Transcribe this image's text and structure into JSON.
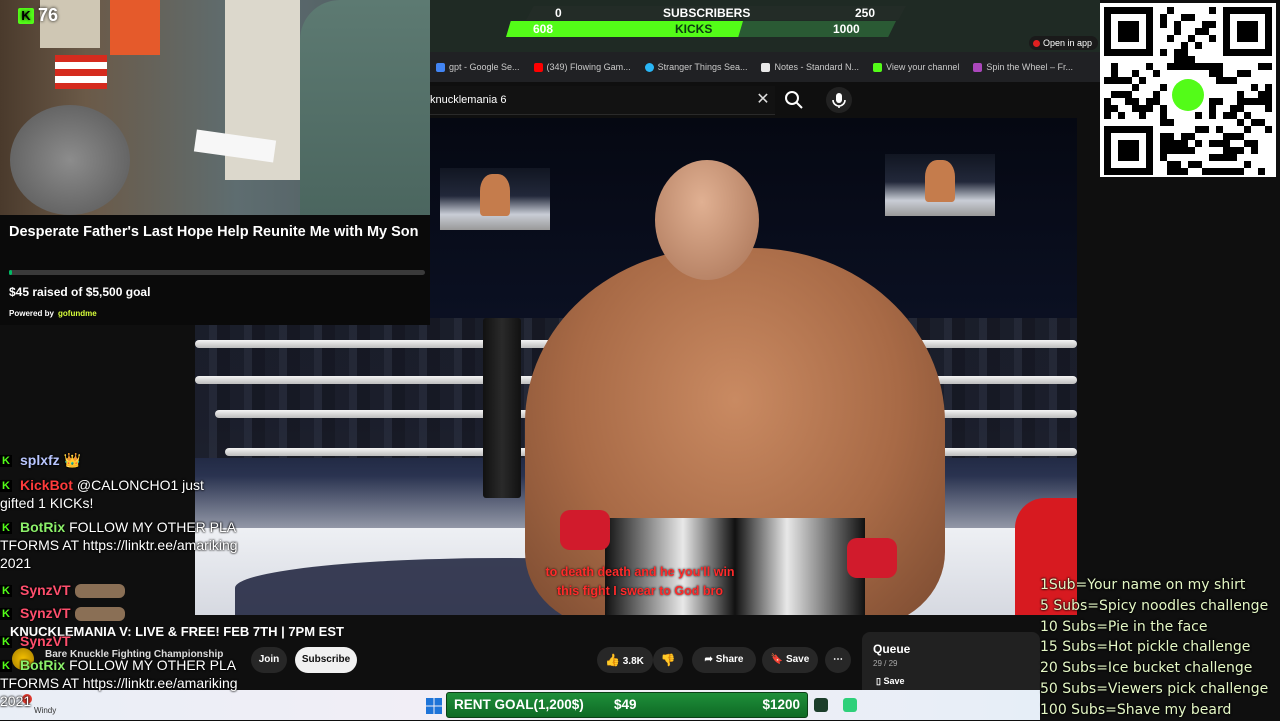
{
  "browser": {
    "bookmarks": [
      {
        "label": "gpt - Google Se...",
        "color": "#4285f4"
      },
      {
        "label": "(349) Flowing Gam...",
        "color": "#ff0000"
      },
      {
        "label": "Stranger Things Sea...",
        "color": "#29b6f6"
      },
      {
        "label": "Notes - Standard N...",
        "color": "#e8e8e8"
      },
      {
        "label": "View your channel",
        "color": "#53fc18"
      },
      {
        "label": "Spin the Wheel – Fr...",
        "color": "#ab47bc"
      }
    ],
    "open_in_app": "Open in app",
    "search_query": "knucklemania 6"
  },
  "webcam": {
    "follower_count": "76"
  },
  "gofundme": {
    "title": "Desperate Father's Last Hope Help Reunite Me with My Son",
    "raised": "$45 raised of $5,500 goal",
    "progress_fraction": 0.008,
    "powered_by": "Powered by",
    "brand": "gofundme"
  },
  "goal_bar": {
    "subs_current": "0",
    "subs_label": "SUBSCRIBERS",
    "subs_goal": "250",
    "kicks_current": "608",
    "kicks_label": "KICKS",
    "kicks_goal": "1000",
    "kicks_fraction": 0.608
  },
  "video": {
    "caption_line1": "to death death and he you'll win",
    "caption_line2": "this fight I swear to God bro"
  },
  "video_info": {
    "title": "KNUCKLEMANIA V: LIVE & FREE! FEB 7TH | 7PM EST",
    "channel": "Bare Knuckle Fighting Championship",
    "join": "Join",
    "subscribe": "Subscribe",
    "likes": "3.8K",
    "share": "Share",
    "save": "Save",
    "queue_title": "Queue",
    "queue_count": "29 / 29",
    "queue_save": "Save"
  },
  "taskbar": {
    "weather": "Windy",
    "rent_goal_label": "RENT GOAL(1,200$)",
    "rent_goal_current": "$49",
    "rent_goal_target": "$1200"
  },
  "chat": [
    {
      "user": "splxfz",
      "color": "#b9c6ff",
      "message": "",
      "emote": "emote-crown"
    },
    {
      "user": "KickBot",
      "color": "#ff3b3b",
      "message": "@CALONCHO1 just gifted 1 KICKs!"
    },
    {
      "user": "BotRix",
      "color": "#8cf06a",
      "message": "FOLLOW MY OTHER PLATFORMS AT https://linktr.ee/amariking2021"
    },
    {
      "user": "SynzVT",
      "color": "#ff4f6d",
      "message": "",
      "emote": "emote-hands"
    },
    {
      "user": "SynzVT",
      "color": "#ff4f6d",
      "message": "",
      "emote": "emote-hands"
    },
    {
      "user": "SynzVT",
      "color": "#ff4f6d",
      "message": "",
      "emote": ""
    },
    {
      "user": "BotRix",
      "color": "#8cf06a",
      "message": "FOLLOW MY OTHER PLATFORMS AT https://linktr.ee/amariking2021"
    }
  ],
  "sub_goals": [
    "1Sub=Your name on my shirt",
    "5 Subs=Spicy noodles challenge",
    "10 Subs=Pie in the face",
    "15 Subs=Hot pickle challenge",
    "20 Subs=Ice bucket challenge",
    "50 Subs=Viewers pick challenge",
    "100 Subs=Shave my beard"
  ],
  "colors": {
    "kick_green": "#53fc18",
    "gofundme_green": "#00b964",
    "rent_goal_green": "#1f8f3a"
  }
}
